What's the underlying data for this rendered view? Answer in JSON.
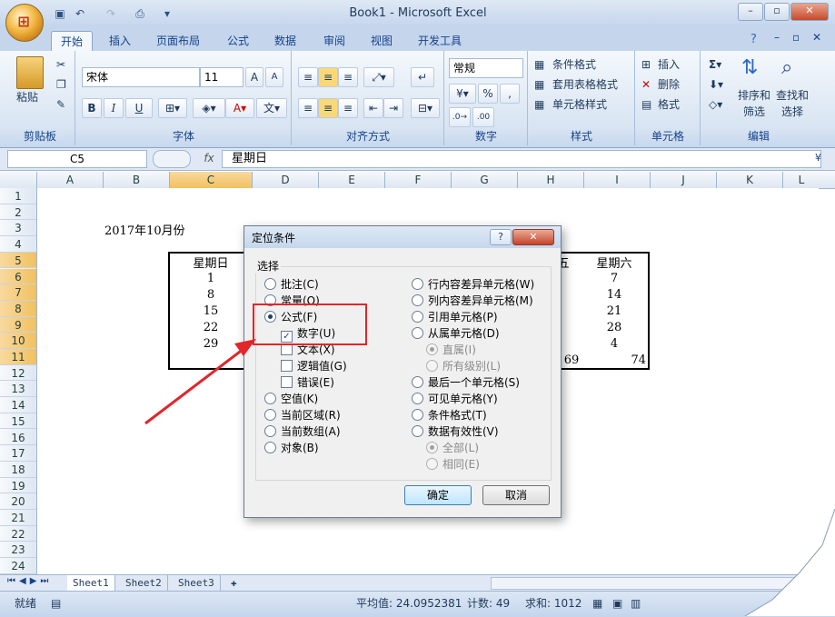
{
  "window": {
    "title": "Book1 - Microsoft Excel",
    "controls": [
      "–",
      "▫",
      "✕"
    ]
  },
  "ribbon_tabs": [
    "开始",
    "插入",
    "页面布局",
    "公式",
    "数据",
    "审阅",
    "视图",
    "开发工具"
  ],
  "ribbon": {
    "clipboard": {
      "label": "剪贴板",
      "paste": "粘贴"
    },
    "font": {
      "label": "字体",
      "name": "宋体",
      "size": "11",
      "bold": "B",
      "italic": "I",
      "underline": "U",
      "grow": "A",
      "shrink": "A"
    },
    "alignment": {
      "label": "对齐方式"
    },
    "number": {
      "label": "数字",
      "format": "常规",
      "percent": "%",
      "comma": ","
    },
    "styles": {
      "label": "样式",
      "cond_format": "条件格式",
      "table_format": "套用表格格式",
      "cell_styles": "单元格样式"
    },
    "cells": {
      "label": "单元格",
      "insert": "插入",
      "delete": "删除",
      "format": "格式"
    },
    "editing": {
      "label": "编辑",
      "sort_filter": "排序和筛选",
      "find_select": "查找和选择"
    }
  },
  "formula_bar": {
    "name_box": "C5",
    "fx": "fx",
    "content": "星期日"
  },
  "columns": [
    "A",
    "B",
    "C",
    "D",
    "E",
    "F",
    "G",
    "H",
    "I",
    "J",
    "K",
    "L"
  ],
  "selected_column": "C",
  "rows": [
    "1",
    "2",
    "3",
    "4",
    "5",
    "6",
    "7",
    "8",
    "9",
    "10",
    "11",
    "12",
    "13",
    "14",
    "15",
    "16",
    "17",
    "18",
    "19",
    "20",
    "21",
    "22",
    "23",
    "24"
  ],
  "selected_rows": [
    "5",
    "6",
    "7",
    "8",
    "9",
    "10",
    "11"
  ],
  "sheet_cells": {
    "title": "2017年10月份",
    "sunday_header": "星期日",
    "sunday_values": [
      "1",
      "8",
      "15",
      "22",
      "29"
    ],
    "saturday_header": "星期六",
    "saturday_values": [
      "7",
      "14",
      "21",
      "28",
      "4"
    ],
    "saturday_total": "74",
    "partial_header": "五",
    "partial_total": "69"
  },
  "sheet_tabs": [
    "Sheet1",
    "Sheet2",
    "Sheet3"
  ],
  "active_sheet": "Sheet1",
  "status": {
    "mode": "就绪",
    "average": "平均值: 24.0952381",
    "count": "计数: 49",
    "sum": "求和: 1012"
  },
  "dialog": {
    "title": "定位条件",
    "help": "?",
    "close": "✕",
    "section": "选择",
    "left_options": [
      {
        "label": "批注(C)",
        "type": "radio",
        "checked": false
      },
      {
        "label": "常量(O)",
        "type": "radio",
        "checked": false
      },
      {
        "label": "公式(F)",
        "type": "radio",
        "checked": true
      },
      {
        "label": "数字(U)",
        "type": "check",
        "checked": true
      },
      {
        "label": "文本(X)",
        "type": "check",
        "checked": false
      },
      {
        "label": "逻辑值(G)",
        "type": "check",
        "checked": false
      },
      {
        "label": "错误(E)",
        "type": "check",
        "checked": false
      },
      {
        "label": "空值(K)",
        "type": "radio",
        "checked": false
      },
      {
        "label": "当前区域(R)",
        "type": "radio",
        "checked": false
      },
      {
        "label": "当前数组(A)",
        "type": "radio",
        "checked": false
      },
      {
        "label": "对象(B)",
        "type": "radio",
        "checked": false
      }
    ],
    "right_options": [
      {
        "label": "行内容差异单元格(W)",
        "type": "radio",
        "checked": false,
        "disabled": false
      },
      {
        "label": "列内容差异单元格(M)",
        "type": "radio",
        "checked": false,
        "disabled": false
      },
      {
        "label": "引用单元格(P)",
        "type": "radio",
        "checked": false,
        "disabled": false
      },
      {
        "label": "从属单元格(D)",
        "type": "radio",
        "checked": false,
        "disabled": false
      },
      {
        "label": "直属(I)",
        "type": "radio",
        "checked": true,
        "disabled": true
      },
      {
        "label": "所有级别(L)",
        "type": "radio",
        "checked": false,
        "disabled": true
      },
      {
        "label": "最后一个单元格(S)",
        "type": "radio",
        "checked": false,
        "disabled": false
      },
      {
        "label": "可见单元格(Y)",
        "type": "radio",
        "checked": false,
        "disabled": false
      },
      {
        "label": "条件格式(T)",
        "type": "radio",
        "checked": false,
        "disabled": false
      },
      {
        "label": "数据有效性(V)",
        "type": "radio",
        "checked": false,
        "disabled": false
      },
      {
        "label": "全部(L)",
        "type": "radio",
        "checked": true,
        "disabled": true
      },
      {
        "label": "相同(E)",
        "type": "radio",
        "checked": false,
        "disabled": true
      }
    ],
    "ok": "确定",
    "cancel": "取消"
  },
  "colors": {
    "highlight": "#e0262a",
    "arrow": "#e0262a",
    "selected_header": "#f1c15f"
  }
}
